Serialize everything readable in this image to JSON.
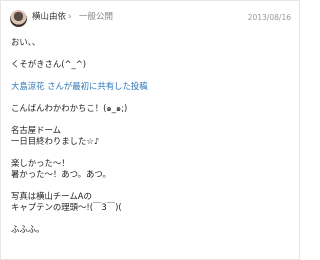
{
  "post": {
    "author": "横山由依",
    "separator": "›",
    "visibility": "一般公開",
    "date": "2013/08/16",
    "lines": [
      "おい、、",
      "くそがきさん(^_^)",
      "大島涼花 さんが最初に共有した投稿",
      "こんばんわかわかちこ！(๑_๑;)",
      "名古屋ドーム",
      "一日目終わりました☆♪",
      "楽しかった〜！",
      "暑かった〜！あつ。あつ。",
      "写真は横山チームAの",
      "キャプテンの理頭〜!(￣3￣)(",
      "ふふふ。"
    ]
  }
}
